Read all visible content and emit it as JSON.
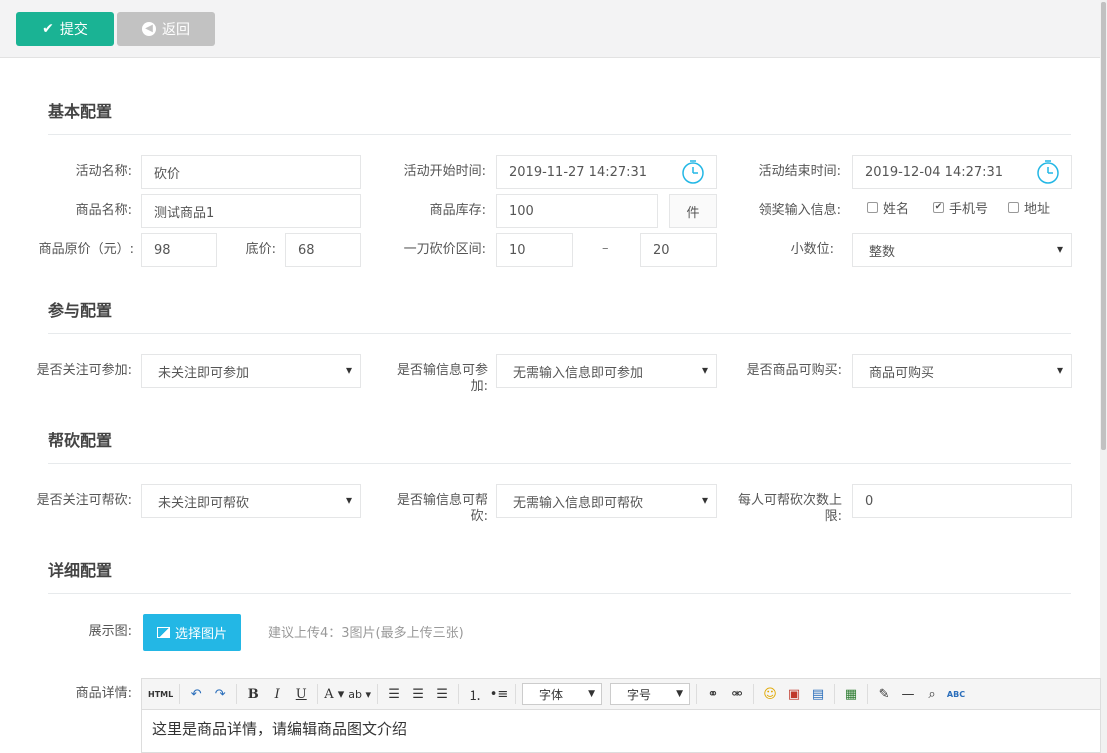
{
  "toolbar": {
    "submit_label": "提交",
    "back_label": "返回"
  },
  "sections": {
    "basic": "基本配置",
    "participate": "参与配置",
    "help": "帮砍配置",
    "detail": "详细配置"
  },
  "basic": {
    "activity_name_label": "活动名称:",
    "activity_name_value": "砍价",
    "start_time_label": "活动开始时间:",
    "start_time_value": "2019-11-27 14:27:31",
    "end_time_label": "活动结束时间:",
    "end_time_value": "2019-12-04 14:27:31",
    "goods_name_label": "商品名称:",
    "goods_name_value": "测试商品1",
    "stock_label": "商品库存:",
    "stock_value": "100",
    "stock_unit": "件",
    "prize_info_label": "领奖输入信息:",
    "prize_options": [
      {
        "label": "姓名",
        "checked": false
      },
      {
        "label": "手机号",
        "checked": true
      },
      {
        "label": "地址",
        "checked": false
      }
    ],
    "original_price_label": "商品原价（元）:",
    "original_price_value": "98",
    "floor_price_label": "底价:",
    "floor_price_value": "68",
    "range_label": "一刀砍价区间:",
    "range_min": "10",
    "range_sep": "–",
    "range_max": "20",
    "decimal_label": "小数位:",
    "decimal_value": "整数"
  },
  "participate": {
    "follow_label": "是否关注可参加:",
    "follow_value": "未关注即可参加",
    "info_label": "是否输信息可参加:",
    "info_value": "无需输入信息即可参加",
    "buy_label": "是否商品可购买:",
    "buy_value": "商品可购买"
  },
  "help": {
    "follow_label": "是否关注可帮砍:",
    "follow_value": "未关注即可帮砍",
    "info_label": "是否输信息可帮砍:",
    "info_value": "无需输入信息即可帮砍",
    "limit_label": "每人可帮砍次数上限:",
    "limit_value": "0"
  },
  "detail": {
    "image_label": "展示图:",
    "image_button": "选择图片",
    "image_hint": "建议上传4：3图片(最多上传三张)",
    "desc_label": "商品详情:",
    "editor_html": "HTML",
    "font_select": "字体",
    "size_select": "字号",
    "editor_content": "这里是商品详情，请编辑商品图文介绍"
  },
  "colors": {
    "primary": "#1ab394",
    "disabled": "#c2c2c2",
    "info": "#23b7e5"
  }
}
